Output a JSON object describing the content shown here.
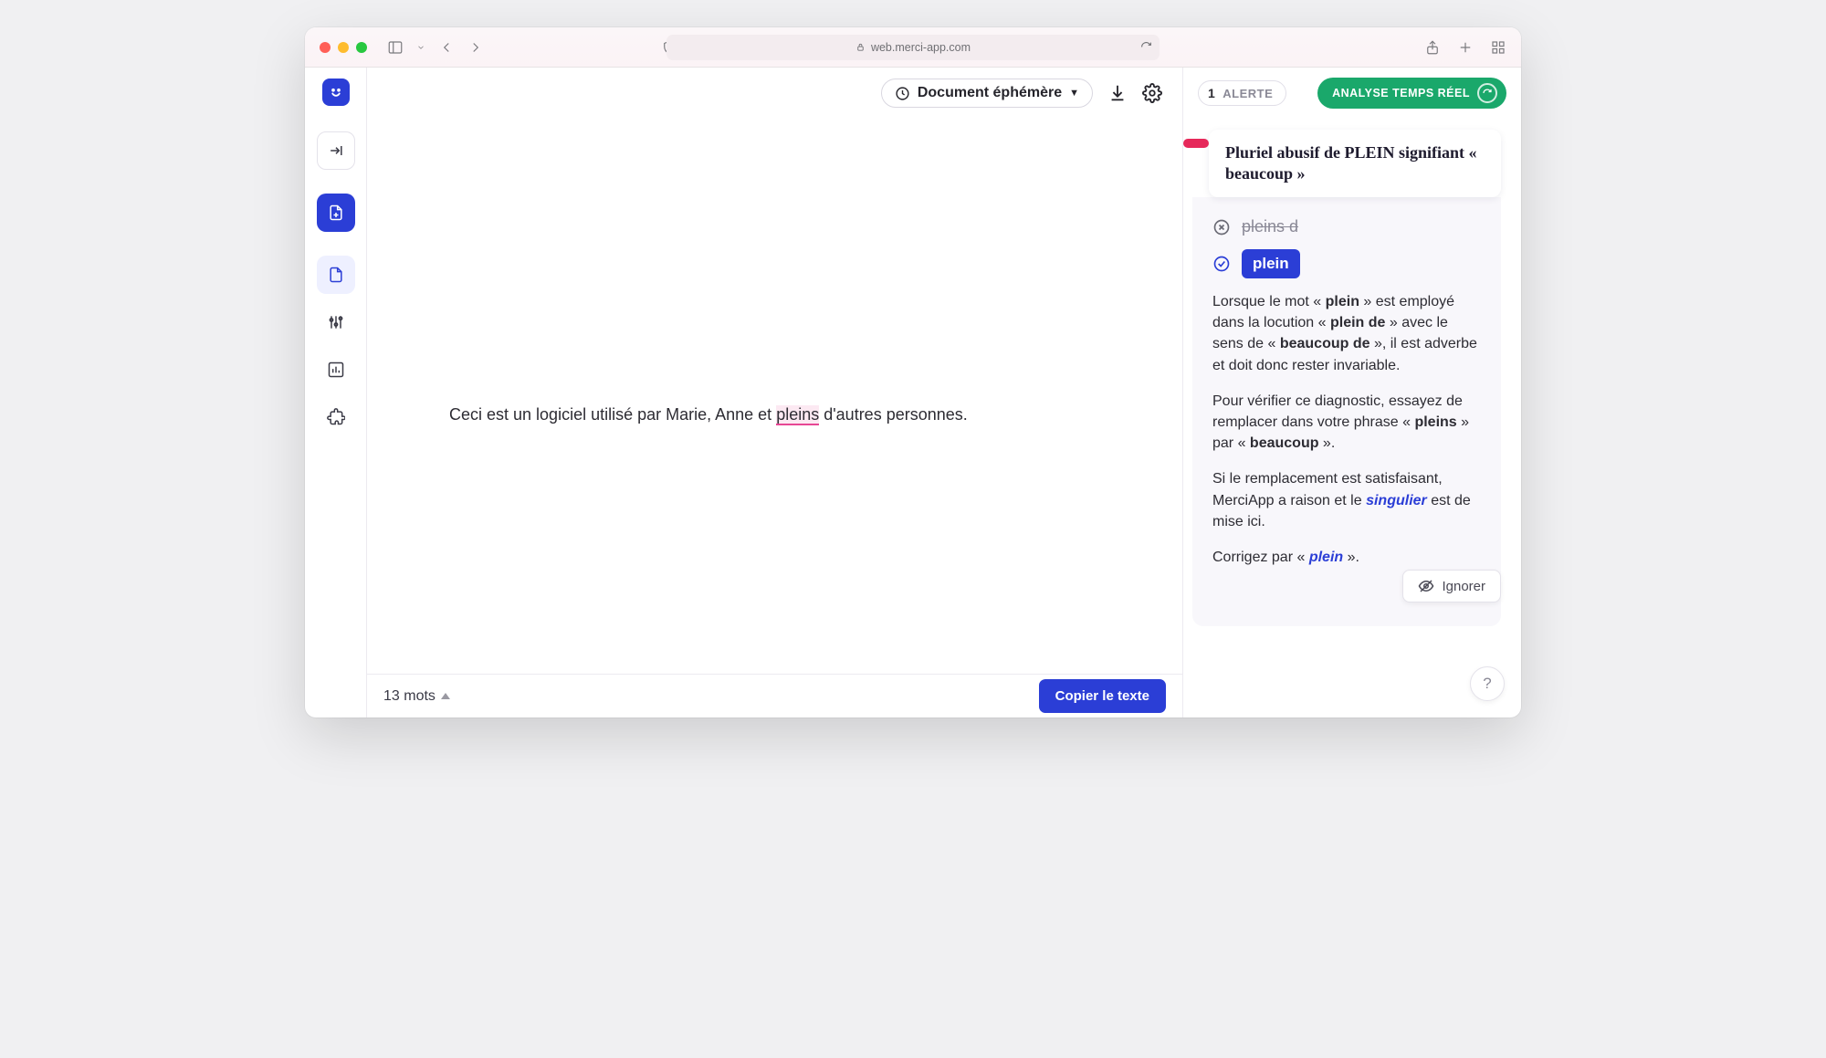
{
  "browser": {
    "url": "web.merci-app.com"
  },
  "toolbar": {
    "doc_button": "Document éphémère"
  },
  "editor": {
    "text_before": "Ceci est un logiciel utilisé par Marie, Anne et ",
    "highlight": "pleins",
    "text_after": " d'autres personnes."
  },
  "status": {
    "word_count": "13 mots",
    "copy_button": "Copier le texte"
  },
  "panel": {
    "alert_count": "1",
    "alert_label": "ALERTE",
    "realtime_label": "ANALYSE TEMPS RÉEL",
    "card_title": "Pluriel abusif de PLEIN signifiant « beaucoup »",
    "wrong_text": "pleins d",
    "fix_text": "plein",
    "p1_a": "Lorsque le mot « ",
    "p1_b1": "plein",
    "p1_c": " » est employé dans la locution « ",
    "p1_b2": "plein de",
    "p1_d": " » avec le sens de « ",
    "p1_b3": "beaucoup de",
    "p1_e": " », il est adverbe et doit donc rester invariable.",
    "p2_a": "Pour vérifier ce diagnostic, essayez de remplacer dans votre phrase « ",
    "p2_b1": "pleins",
    "p2_b": " » par « ",
    "p2_b2": "beaucoup",
    "p2_c": " ».",
    "p3_a": "Si le remplacement est satisfaisant, MerciApp a raison et le ",
    "p3_i": "singulier",
    "p3_b": " est de mise ici.",
    "p4_a": "Corrigez par « ",
    "p4_i": "plein",
    "p4_b": " ».",
    "ignore": "Ignorer"
  }
}
